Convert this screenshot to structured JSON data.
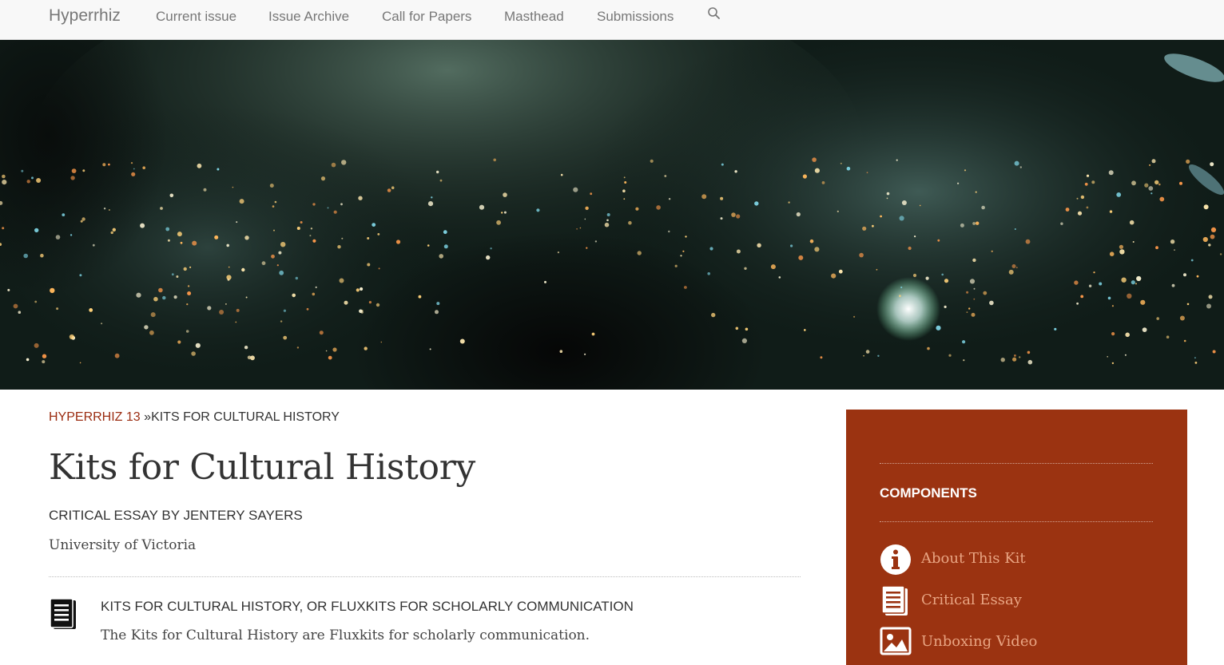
{
  "navbar": {
    "brand": "Hyperrhiz",
    "items": [
      {
        "label": "Current issue"
      },
      {
        "label": "Issue Archive"
      },
      {
        "label": "Call for Papers"
      },
      {
        "label": "Masthead"
      },
      {
        "label": "Submissions"
      }
    ],
    "search_icon": "search-icon"
  },
  "breadcrumb": {
    "parent": "HYPERRHIZ 13",
    "separator": "»",
    "current": "KITS FOR CULTURAL HISTORY"
  },
  "article": {
    "title": "Kits for Cultural History",
    "byline": "CRITICAL ESSAY BY JENTERY SAYERS",
    "affiliation": "University of Victoria",
    "section_icon": "document-icon",
    "section_heading": "KITS FOR CULTURAL HISTORY, OR FLUXKITS FOR SCHOLARLY COMMUNICATION",
    "section_text": "The Kits for Cultural History are Fluxkits for scholarly communication."
  },
  "sidebar": {
    "title": "COMPONENTS",
    "items": [
      {
        "label": "About This Kit",
        "icon": "info-icon"
      },
      {
        "label": "Critical Essay",
        "icon": "document-icon"
      },
      {
        "label": "Unboxing Video",
        "icon": "image-icon"
      }
    ]
  },
  "colors": {
    "accent": "#9b3311",
    "link": "#9b2d12",
    "sidebar_link": "#e9a583",
    "navbar_bg": "#f8f8f8"
  }
}
